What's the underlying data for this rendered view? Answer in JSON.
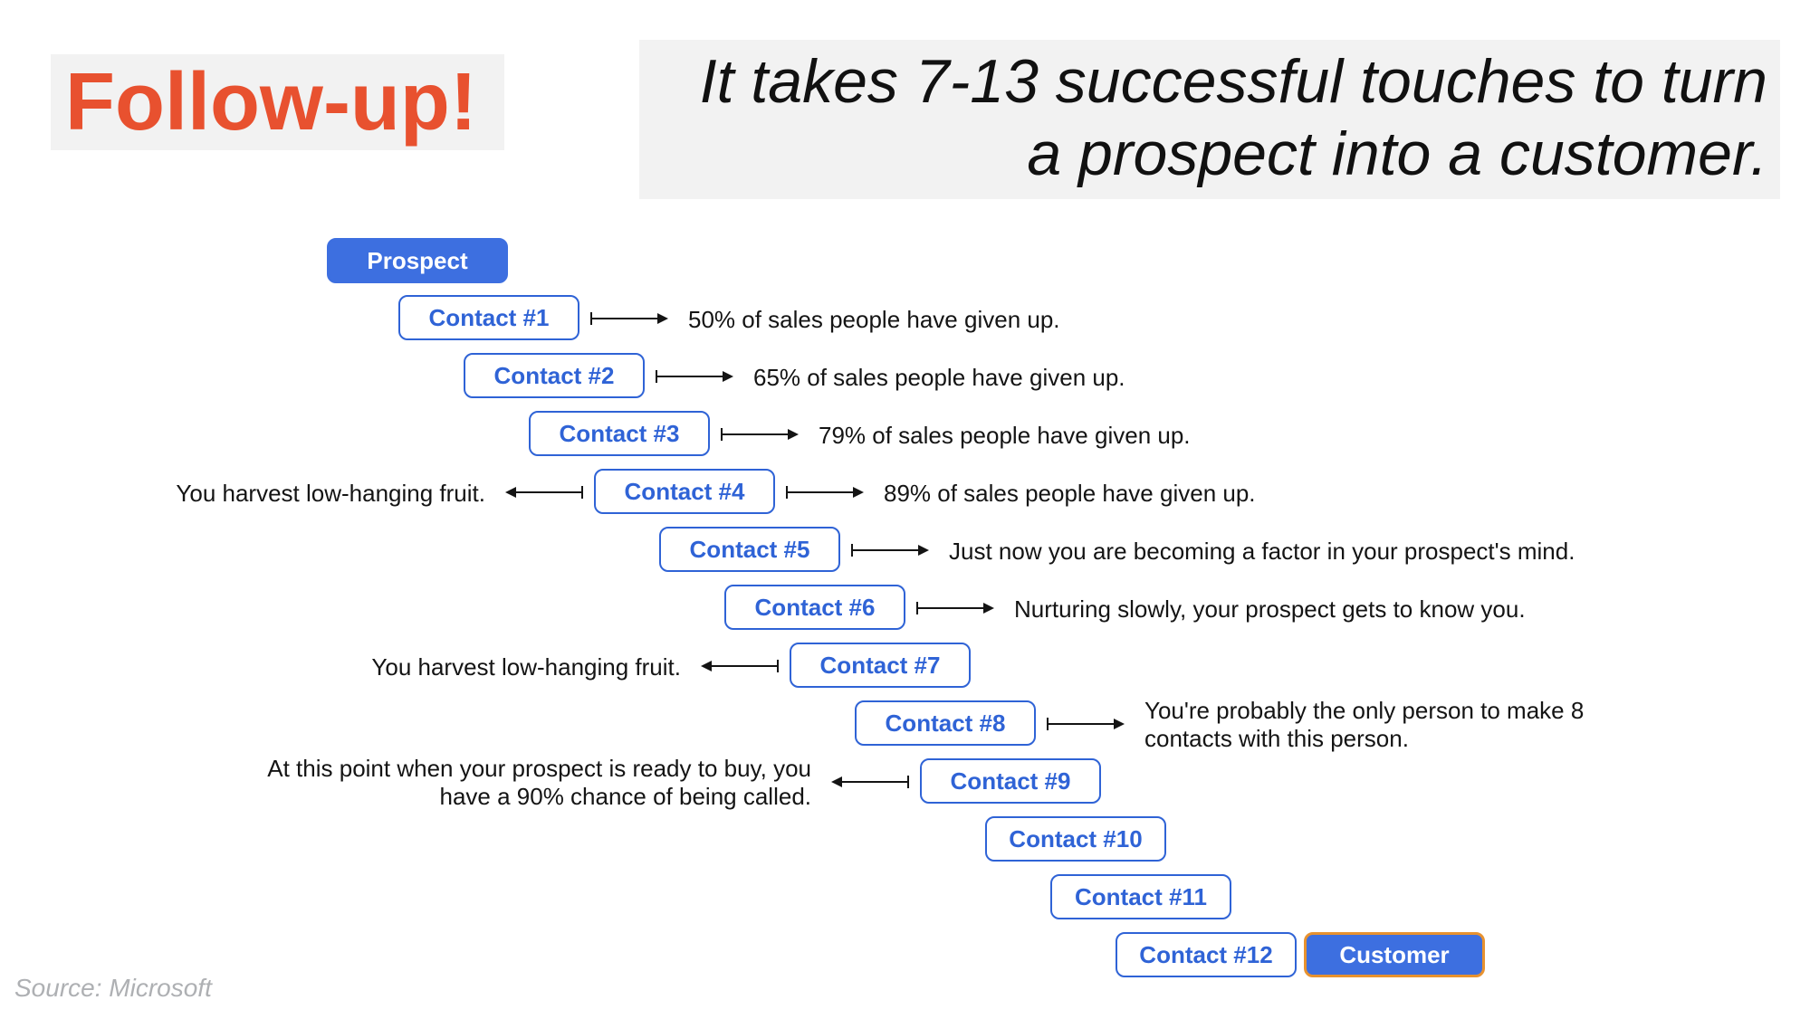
{
  "title": "Follow-up!",
  "subtitle": "It takes 7-13 successful touches to turn a prospect into a customer.",
  "source": "Source: Microsoft",
  "start_label": "Prospect",
  "end_label": "Customer",
  "contacts": [
    {
      "label": "Contact #1",
      "right": "50% of sales people have given up."
    },
    {
      "label": "Contact #2",
      "right": "65% of sales people have given up."
    },
    {
      "label": "Contact #3",
      "right": "79% of sales people have given up."
    },
    {
      "label": "Contact #4",
      "right": "89% of sales people have given up.",
      "left": "You harvest low-hanging fruit."
    },
    {
      "label": "Contact #5",
      "right": "Just now you are becoming a factor in your prospect's mind."
    },
    {
      "label": "Contact #6",
      "right": "Nurturing slowly, your prospect gets to know you."
    },
    {
      "label": "Contact #7",
      "left": "You harvest low-hanging fruit."
    },
    {
      "label": "Contact #8",
      "right": "You're probably the only person to make 8 contacts with this person."
    },
    {
      "label": "Contact #9",
      "left": "At this point when your prospect is ready to buy, you have a 90% chance of being called."
    },
    {
      "label": "Contact #10"
    },
    {
      "label": "Contact #11"
    },
    {
      "label": "Contact #12"
    }
  ]
}
